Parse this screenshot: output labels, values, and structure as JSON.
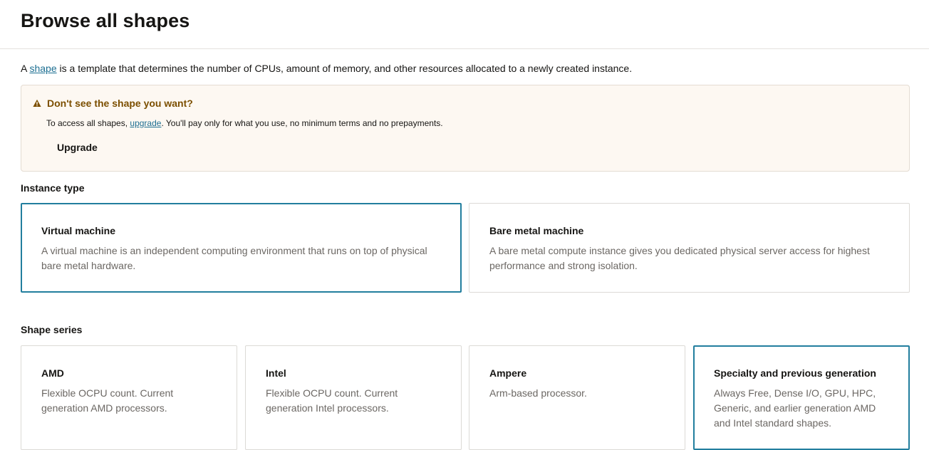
{
  "header": {
    "title": "Browse all shapes"
  },
  "intro": {
    "prefix": "A ",
    "link": "shape",
    "suffix": " is a template that determines the number of CPUs, amount of memory, and other resources allocated to a newly created instance."
  },
  "notice": {
    "title": "Don't see the shape you want?",
    "body_prefix": "To access all shapes, ",
    "body_link": "upgrade",
    "body_suffix": ". You'll pay only for what you use, no minimum terms and no prepayments.",
    "button_label": "Upgrade",
    "icon": "warning-icon",
    "title_color": "#7c4f00"
  },
  "instance_type": {
    "label": "Instance type",
    "options": [
      {
        "title": "Virtual machine",
        "description": "A virtual machine is an independent computing environment that runs on top of physical bare metal hardware.",
        "selected": true
      },
      {
        "title": "Bare metal machine",
        "description": "A bare metal compute instance gives you dedicated physical server access for highest performance and strong isolation.",
        "selected": false
      }
    ]
  },
  "shape_series": {
    "label": "Shape series",
    "options": [
      {
        "title": "AMD",
        "description": "Flexible OCPU count. Current generation AMD processors.",
        "selected": false
      },
      {
        "title": "Intel",
        "description": "Flexible OCPU count. Current generation Intel processors.",
        "selected": false
      },
      {
        "title": "Ampere",
        "description": "Arm-based processor.",
        "selected": false
      },
      {
        "title": "Specialty and previous generation",
        "description": "Always Free, Dense I/O, GPU, HPC, Generic, and earlier generation AMD and Intel standard shapes.",
        "selected": true
      }
    ]
  },
  "colors": {
    "selected_border": "#227e9e",
    "link": "#1d6f92",
    "notice_bg": "#fdf8f2"
  }
}
